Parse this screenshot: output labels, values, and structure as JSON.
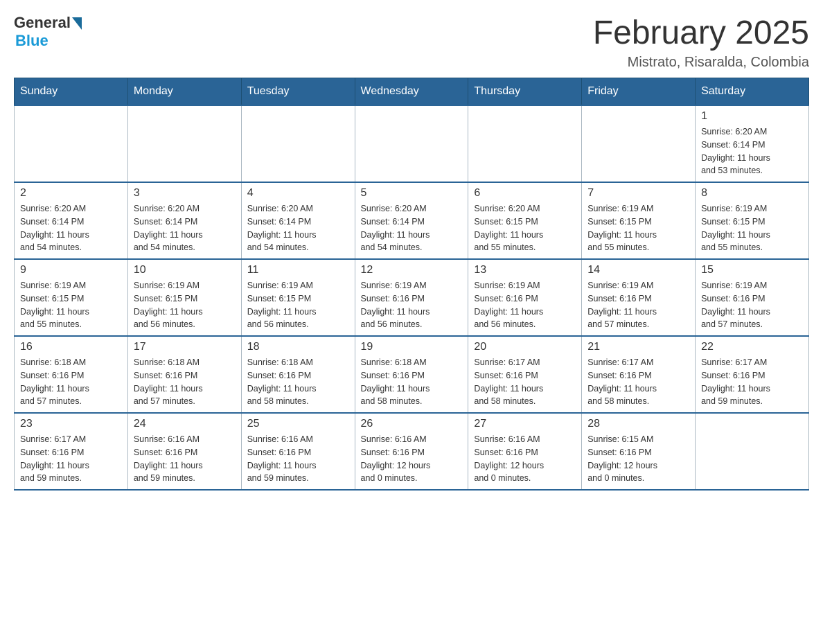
{
  "logo": {
    "general": "General",
    "blue": "Blue"
  },
  "title": "February 2025",
  "location": "Mistrato, Risaralda, Colombia",
  "weekdays": [
    "Sunday",
    "Monday",
    "Tuesday",
    "Wednesday",
    "Thursday",
    "Friday",
    "Saturday"
  ],
  "weeks": [
    [
      {
        "day": "",
        "info": ""
      },
      {
        "day": "",
        "info": ""
      },
      {
        "day": "",
        "info": ""
      },
      {
        "day": "",
        "info": ""
      },
      {
        "day": "",
        "info": ""
      },
      {
        "day": "",
        "info": ""
      },
      {
        "day": "1",
        "info": "Sunrise: 6:20 AM\nSunset: 6:14 PM\nDaylight: 11 hours\nand 53 minutes."
      }
    ],
    [
      {
        "day": "2",
        "info": "Sunrise: 6:20 AM\nSunset: 6:14 PM\nDaylight: 11 hours\nand 54 minutes."
      },
      {
        "day": "3",
        "info": "Sunrise: 6:20 AM\nSunset: 6:14 PM\nDaylight: 11 hours\nand 54 minutes."
      },
      {
        "day": "4",
        "info": "Sunrise: 6:20 AM\nSunset: 6:14 PM\nDaylight: 11 hours\nand 54 minutes."
      },
      {
        "day": "5",
        "info": "Sunrise: 6:20 AM\nSunset: 6:14 PM\nDaylight: 11 hours\nand 54 minutes."
      },
      {
        "day": "6",
        "info": "Sunrise: 6:20 AM\nSunset: 6:15 PM\nDaylight: 11 hours\nand 55 minutes."
      },
      {
        "day": "7",
        "info": "Sunrise: 6:19 AM\nSunset: 6:15 PM\nDaylight: 11 hours\nand 55 minutes."
      },
      {
        "day": "8",
        "info": "Sunrise: 6:19 AM\nSunset: 6:15 PM\nDaylight: 11 hours\nand 55 minutes."
      }
    ],
    [
      {
        "day": "9",
        "info": "Sunrise: 6:19 AM\nSunset: 6:15 PM\nDaylight: 11 hours\nand 55 minutes."
      },
      {
        "day": "10",
        "info": "Sunrise: 6:19 AM\nSunset: 6:15 PM\nDaylight: 11 hours\nand 56 minutes."
      },
      {
        "day": "11",
        "info": "Sunrise: 6:19 AM\nSunset: 6:15 PM\nDaylight: 11 hours\nand 56 minutes."
      },
      {
        "day": "12",
        "info": "Sunrise: 6:19 AM\nSunset: 6:16 PM\nDaylight: 11 hours\nand 56 minutes."
      },
      {
        "day": "13",
        "info": "Sunrise: 6:19 AM\nSunset: 6:16 PM\nDaylight: 11 hours\nand 56 minutes."
      },
      {
        "day": "14",
        "info": "Sunrise: 6:19 AM\nSunset: 6:16 PM\nDaylight: 11 hours\nand 57 minutes."
      },
      {
        "day": "15",
        "info": "Sunrise: 6:19 AM\nSunset: 6:16 PM\nDaylight: 11 hours\nand 57 minutes."
      }
    ],
    [
      {
        "day": "16",
        "info": "Sunrise: 6:18 AM\nSunset: 6:16 PM\nDaylight: 11 hours\nand 57 minutes."
      },
      {
        "day": "17",
        "info": "Sunrise: 6:18 AM\nSunset: 6:16 PM\nDaylight: 11 hours\nand 57 minutes."
      },
      {
        "day": "18",
        "info": "Sunrise: 6:18 AM\nSunset: 6:16 PM\nDaylight: 11 hours\nand 58 minutes."
      },
      {
        "day": "19",
        "info": "Sunrise: 6:18 AM\nSunset: 6:16 PM\nDaylight: 11 hours\nand 58 minutes."
      },
      {
        "day": "20",
        "info": "Sunrise: 6:17 AM\nSunset: 6:16 PM\nDaylight: 11 hours\nand 58 minutes."
      },
      {
        "day": "21",
        "info": "Sunrise: 6:17 AM\nSunset: 6:16 PM\nDaylight: 11 hours\nand 58 minutes."
      },
      {
        "day": "22",
        "info": "Sunrise: 6:17 AM\nSunset: 6:16 PM\nDaylight: 11 hours\nand 59 minutes."
      }
    ],
    [
      {
        "day": "23",
        "info": "Sunrise: 6:17 AM\nSunset: 6:16 PM\nDaylight: 11 hours\nand 59 minutes."
      },
      {
        "day": "24",
        "info": "Sunrise: 6:16 AM\nSunset: 6:16 PM\nDaylight: 11 hours\nand 59 minutes."
      },
      {
        "day": "25",
        "info": "Sunrise: 6:16 AM\nSunset: 6:16 PM\nDaylight: 11 hours\nand 59 minutes."
      },
      {
        "day": "26",
        "info": "Sunrise: 6:16 AM\nSunset: 6:16 PM\nDaylight: 12 hours\nand 0 minutes."
      },
      {
        "day": "27",
        "info": "Sunrise: 6:16 AM\nSunset: 6:16 PM\nDaylight: 12 hours\nand 0 minutes."
      },
      {
        "day": "28",
        "info": "Sunrise: 6:15 AM\nSunset: 6:16 PM\nDaylight: 12 hours\nand 0 minutes."
      },
      {
        "day": "",
        "info": ""
      }
    ]
  ]
}
